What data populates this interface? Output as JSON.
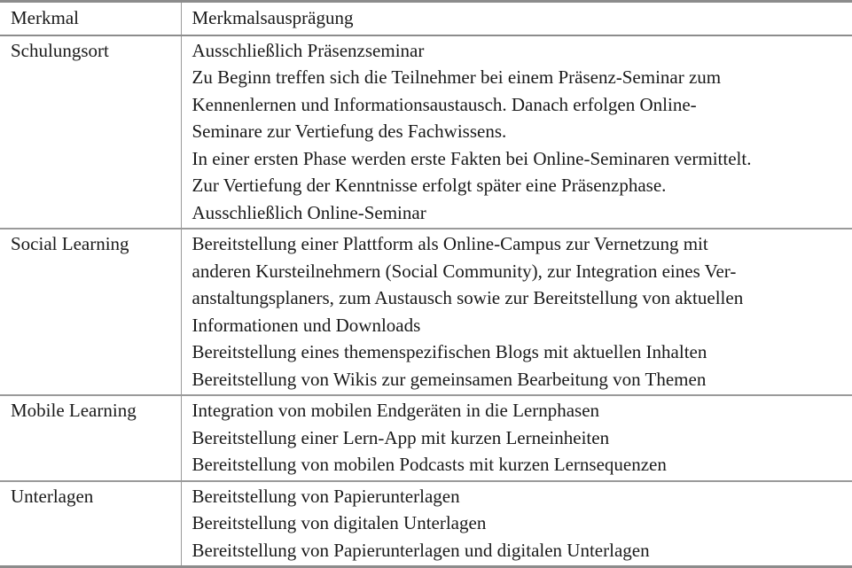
{
  "header": {
    "feature": "Merkmal",
    "characteristic": "Merkmalsausprägung"
  },
  "rows": [
    {
      "feature": "Schulungsort",
      "lines": [
        "Ausschließlich Präsenzseminar",
        "Zu Beginn treffen sich die Teilnehmer bei einem Präsenz-Seminar zum",
        "Kennenlernen und Informationsaustausch. Danach erfolgen Online-",
        "Seminare zur Vertiefung des Fachwissens.",
        "In einer ersten Phase werden erste Fakten bei Online-Seminaren vermittelt.",
        "Zur Vertiefung der Kenntnisse erfolgt später eine Präsenzphase.",
        "Ausschließlich Online-Seminar"
      ]
    },
    {
      "feature": "Social Learning",
      "lines": [
        "Bereitstellung einer Plattform als Online-Campus zur Vernetzung mit",
        "anderen Kursteilnehmern (Social Community), zur Integration eines Ver-",
        "anstaltungsplaners, zum Austausch sowie zur Bereitstellung von aktuellen",
        "Informationen und Downloads",
        "Bereitstellung eines themenspezifischen Blogs mit aktuellen Inhalten",
        "Bereitstellung von Wikis zur gemeinsamen Bearbeitung von Themen"
      ]
    },
    {
      "feature": "Mobile Learning",
      "lines": [
        "Integration von mobilen Endgeräten in die Lernphasen",
        "Bereitstellung einer Lern-App mit kurzen Lerneinheiten",
        "Bereitstellung von mobilen Podcasts mit kurzen Lernsequenzen"
      ]
    },
    {
      "feature": "Unterlagen",
      "lines": [
        "Bereitstellung von Papierunterlagen",
        "Bereitstellung von digitalen Unterlagen",
        "Bereitstellung von Papierunterlagen und digitalen Unterlagen"
      ]
    }
  ]
}
